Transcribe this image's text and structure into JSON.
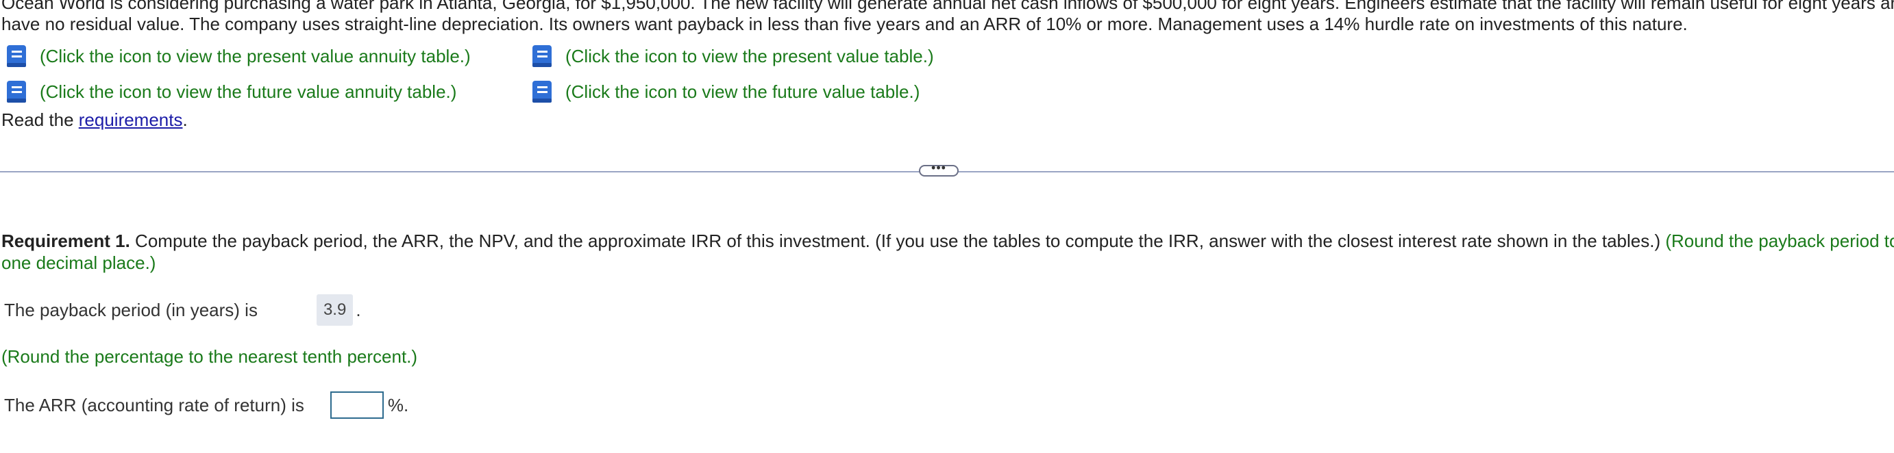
{
  "problem": {
    "intro_text": "Ocean World is considering purchasing a water park in Atlanta, Georgia, for $1,950,000. The new facility will generate annual net cash inflows of $500,000 for eight years. Engineers estimate that the facility will remain useful for eight years and have no residual value. The company uses straight-line depreciation. Its owners want payback in less than five years and an ARR of 10% or more. Management uses a 14% hurdle rate on investments of this nature."
  },
  "table_links": {
    "pv_annuity": "(Click the icon to view the present value annuity table.)",
    "pv": "(Click the icon to view the present value table.)",
    "fv_annuity": "(Click the icon to view the future value annuity table.)",
    "fv": "(Click the icon to view the future value table.)",
    "icon": "book-icon",
    "link_color": "#1a7a1a",
    "icon_color": "#2f6fd6"
  },
  "read": {
    "prefix": "Read the ",
    "link": "requirements",
    "suffix": "."
  },
  "expand_button": {
    "label": "•••"
  },
  "requirement": {
    "label": "Requirement 1.",
    "text": " Compute the payback period, the ARR, the NPV, and the approximate IRR of this investment. (If you use the tables to compute the IRR, answer with the closest interest rate shown in the tables.) ",
    "instruction": "(Round the payback period to one decimal place.)"
  },
  "payback": {
    "label": "The payback period (in years) is",
    "value": "3.9",
    "suffix": "."
  },
  "round_note": "(Round the percentage to the nearest tenth percent.)",
  "arr": {
    "label": "The ARR (accounting rate of return) is",
    "value": "",
    "suffix": "%."
  }
}
